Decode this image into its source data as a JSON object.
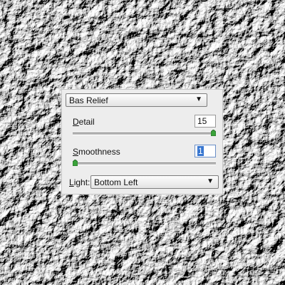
{
  "filter": {
    "selected": "Bas Relief",
    "dropdown_icon": "triangle-down"
  },
  "detail": {
    "label_access_key": "D",
    "label_rest": "etail",
    "value": "15",
    "slider_fraction": 1.0
  },
  "smoothness": {
    "label_access_key": "S",
    "label_rest": "moothness",
    "value": "1",
    "slider_fraction": 0.0
  },
  "light": {
    "label_access_key": "L",
    "label_rest": "ight:",
    "selected": "Bottom Left",
    "dropdown_icon": "triangle-down"
  },
  "colors": {
    "panel_bg": "#ededed",
    "selection": "#3776d0"
  }
}
